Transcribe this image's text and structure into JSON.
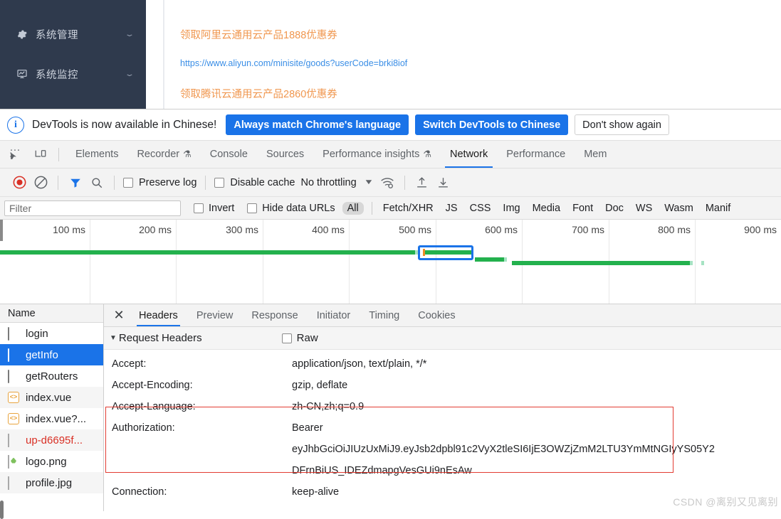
{
  "webpage": {
    "sidebar": {
      "items": [
        {
          "icon": "gear-icon",
          "label": "系统管理",
          "arrow": "⌄"
        },
        {
          "icon": "monitor-chart-icon",
          "label": "系统监控",
          "arrow": "⌄"
        }
      ]
    },
    "ads": [
      {
        "text": "领取阿里云通用云产品1888优惠券",
        "color": "#f0974f"
      },
      {
        "text": "https://www.aliyun.com/minisite/goods?userCode=brki8iof",
        "color": "#3a8ee6"
      },
      {
        "text": "领取腾讯云通用云产品2860优惠券",
        "color": "#f0974f"
      }
    ]
  },
  "devtools": {
    "infobar": {
      "message": "DevTools is now available in Chinese!",
      "buttons": [
        {
          "label": "Always match Chrome's language",
          "style": "primary"
        },
        {
          "label": "Switch DevTools to Chinese",
          "style": "primary"
        },
        {
          "label": "Don't show again",
          "style": "ghost"
        }
      ]
    },
    "tabs": [
      {
        "label": "Elements",
        "active": false,
        "flask": false
      },
      {
        "label": "Recorder",
        "active": false,
        "flask": true
      },
      {
        "label": "Console",
        "active": false,
        "flask": false
      },
      {
        "label": "Sources",
        "active": false,
        "flask": false
      },
      {
        "label": "Performance insights",
        "active": false,
        "flask": true
      },
      {
        "label": "Network",
        "active": true,
        "flask": false
      },
      {
        "label": "Performance",
        "active": false,
        "flask": false
      },
      {
        "label": "Mem",
        "active": false,
        "flask": false
      }
    ],
    "network_toolbar": {
      "preserve_log_label": "Preserve log",
      "disable_cache_label": "Disable cache",
      "throttling_label": "No throttling"
    },
    "filter_bar": {
      "filter_placeholder": "Filter",
      "filter_value": "",
      "invert_label": "Invert",
      "hide_data_urls_label": "Hide data URLs",
      "types": [
        {
          "label": "All",
          "selected": true
        },
        {
          "label": "Fetch/XHR",
          "selected": false
        },
        {
          "label": "JS",
          "selected": false
        },
        {
          "label": "CSS",
          "selected": false
        },
        {
          "label": "Img",
          "selected": false
        },
        {
          "label": "Media",
          "selected": false
        },
        {
          "label": "Font",
          "selected": false
        },
        {
          "label": "Doc",
          "selected": false
        },
        {
          "label": "WS",
          "selected": false
        },
        {
          "label": "Wasm",
          "selected": false
        },
        {
          "label": "Manif",
          "selected": false
        }
      ]
    },
    "overview": {
      "ticks": [
        "100 ms",
        "200 ms",
        "300 ms",
        "400 ms",
        "500 ms",
        "600 ms",
        "700 ms",
        "800 ms",
        "900 ms"
      ],
      "accent_color": "#23b14d",
      "selection_color": "#1a73e8"
    },
    "requests": {
      "column_header": "Name",
      "rows": [
        {
          "name": "login",
          "icon": "doc-icon",
          "state": "normal"
        },
        {
          "name": "getInfo",
          "icon": "doc-icon",
          "state": "selected"
        },
        {
          "name": "getRouters",
          "icon": "doc-icon",
          "state": "normal"
        },
        {
          "name": "index.vue",
          "icon": "script-icon",
          "state": "normal"
        },
        {
          "name": "index.vue?...",
          "icon": "script-icon",
          "state": "normal"
        },
        {
          "name": "up-d6695f...",
          "icon": "image-icon",
          "state": "error"
        },
        {
          "name": "logo.png",
          "icon": "image-icon",
          "state": "normal"
        },
        {
          "name": "profile.jpg",
          "icon": "image-icon",
          "state": "normal"
        }
      ]
    },
    "detail": {
      "tabs": [
        {
          "label": "Headers",
          "active": true
        },
        {
          "label": "Preview",
          "active": false
        },
        {
          "label": "Response",
          "active": false
        },
        {
          "label": "Initiator",
          "active": false
        },
        {
          "label": "Timing",
          "active": false
        },
        {
          "label": "Cookies",
          "active": false
        }
      ],
      "section_title": "Request Headers",
      "raw_label": "Raw",
      "headers": [
        {
          "key": "Accept:",
          "value": "application/json, text/plain, */*"
        },
        {
          "key": "Accept-Encoding:",
          "value": "gzip, deflate"
        },
        {
          "key": "Accept-Language:",
          "value": "zh-CN,zh;q=0.9"
        },
        {
          "key": "Authorization:",
          "value_lines": [
            "Bearer",
            "eyJhbGciOiJIUzUxMiJ9.eyJsb2dpbl91c2VyX2tleSI6IjE3OWZjZmM2LTU3YmMtNGIyYS05Y2",
            "DFrnBiUS_IDEZdmapgVesGUi9nEsAw"
          ],
          "highlighted": true
        },
        {
          "key": "Connection:",
          "value": "keep-alive"
        }
      ],
      "watermark": "CSDN @离别又见离别"
    }
  }
}
